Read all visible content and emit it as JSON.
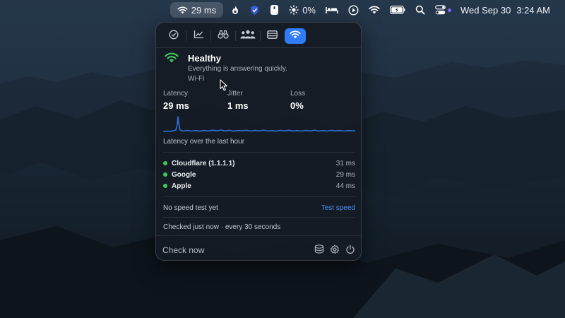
{
  "menubar": {
    "wifi_latency": "29 ms",
    "cpu_percent": "0%",
    "date": "Wed Sep 30",
    "time": "3:24 AM",
    "icons": [
      "wifi-icon",
      "flame-icon",
      "shield-icon",
      "mouse-icon",
      "sun-icon",
      "bed-icon",
      "play-icon",
      "wifi-icon",
      "battery-icon",
      "search-icon",
      "control-center-icon"
    ]
  },
  "popover": {
    "tabs": [
      {
        "icon": "checkmark-circle-icon"
      },
      {
        "icon": "line-chart-icon"
      },
      {
        "icon": "binoculars-icon"
      },
      {
        "icon": "people-icon"
      },
      {
        "icon": "server-icon"
      },
      {
        "icon": "wifi-icon",
        "active": true
      }
    ],
    "status": {
      "title": "Healthy",
      "subtitle": "Everything is answering quickly.",
      "network": "Wi-Fi"
    },
    "metrics": [
      {
        "label": "Latency",
        "value": "29 ms"
      },
      {
        "label": "Jitter",
        "value": "1 ms"
      },
      {
        "label": "Loss",
        "value": "0%"
      }
    ],
    "chart_caption": "Latency over the last hour",
    "targets": [
      {
        "name": "Cloudflare (1.1.1.1)",
        "ms": "31 ms"
      },
      {
        "name": "Google",
        "ms": "29 ms"
      },
      {
        "name": "Apple",
        "ms": "44 ms"
      }
    ],
    "speed": {
      "status": "No speed test yet",
      "action": "Test speed"
    },
    "checked": "Checked just now · every 30 seconds",
    "footer": {
      "check_now": "Check now",
      "icons": [
        "database-icon",
        "gear-icon",
        "power-icon"
      ]
    }
  },
  "colors": {
    "accent": "#2f7cf6",
    "healthy": "#3ec95b",
    "link": "#4a91f7",
    "sparkline": "#2f6fd8"
  }
}
